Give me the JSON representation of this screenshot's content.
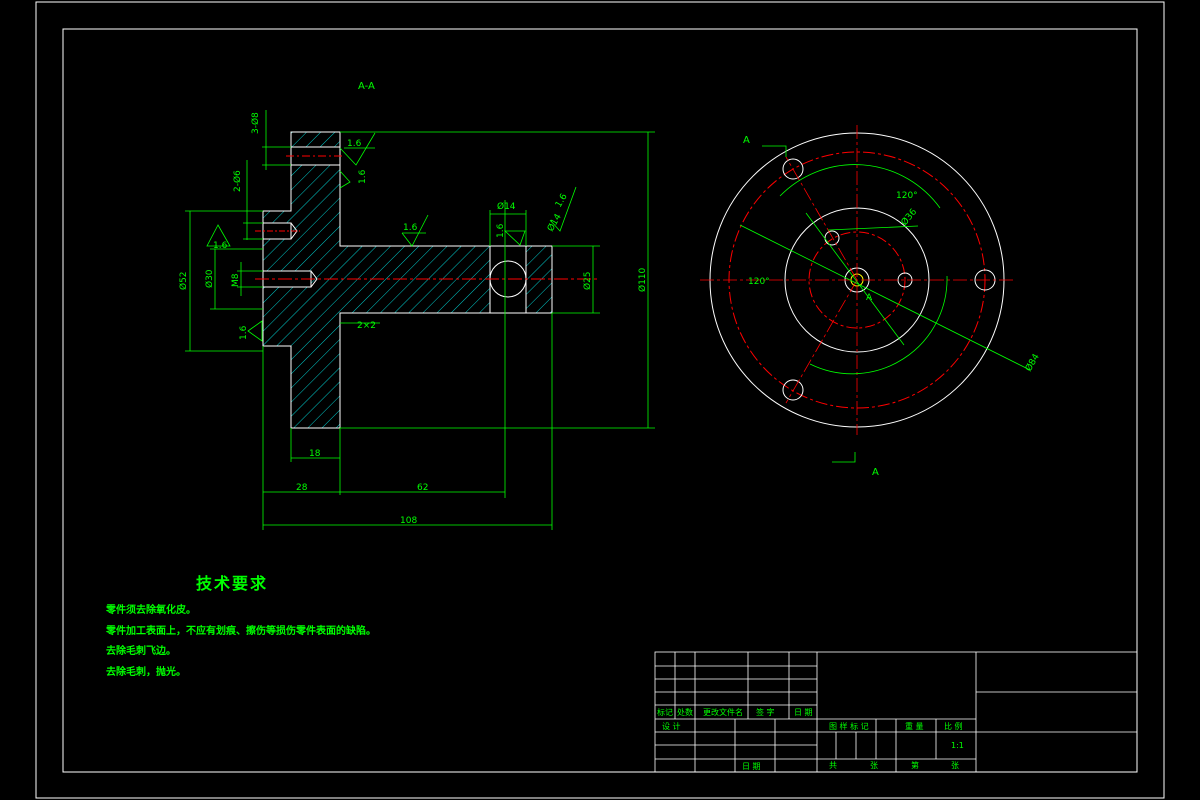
{
  "drawing": {
    "section_label": "A-A",
    "view_arrow_label_top": "A",
    "view_arrow_label_bottom": "A",
    "view_arrow_label_center": "A",
    "dims": {
      "d_3x8": "3-Ø8",
      "d_2x6": "2-Ø6",
      "d_52": "Ø52",
      "d_30": "Ø30",
      "m8": "M8",
      "d_14_top": "Ø14",
      "d_14_side": "Ø14",
      "d_25": "Ø25",
      "d_110": "Ø110",
      "len_18": "18",
      "len_28": "28",
      "len_62": "62",
      "len_108": "108",
      "chamfer": "2×2",
      "angle_120a": "120°",
      "angle_120b": "120°",
      "d_36": "Ø36",
      "d_84": "Ø84"
    },
    "roughness": {
      "r1": "1.6",
      "r2": "1.6",
      "r3": "1.6",
      "r4": "1.6",
      "r5": "1.6",
      "r6": "1.6",
      "r7": "1.6",
      "r8": "1.6"
    }
  },
  "tech_requirements": {
    "title": "技术要求",
    "items": [
      "零件须去除氧化皮。",
      "零件加工表面上，不应有划痕、擦伤等损伤零件表面的缺陷。",
      "去除毛刺飞边。",
      "去除毛刺，抛光。"
    ]
  },
  "title_block": {
    "rev_headers": [
      "标记",
      "处数",
      "更改文件名",
      "签 字",
      "日 期"
    ],
    "design": "设 计",
    "date": "日 期",
    "drawing_mark": "图 样 标 记",
    "weight": "重 量",
    "scale": "比 例",
    "scale_value": "1:1",
    "sheet_total": "共",
    "sheet_total_unit": "张",
    "sheet_no": "第",
    "sheet_no_unit": "张"
  },
  "colors": {
    "frame": "#ffffff",
    "dimension": "#00ff00",
    "centerline": "#ff0000",
    "hatch": "#00ffff",
    "text": "#00ff00"
  }
}
